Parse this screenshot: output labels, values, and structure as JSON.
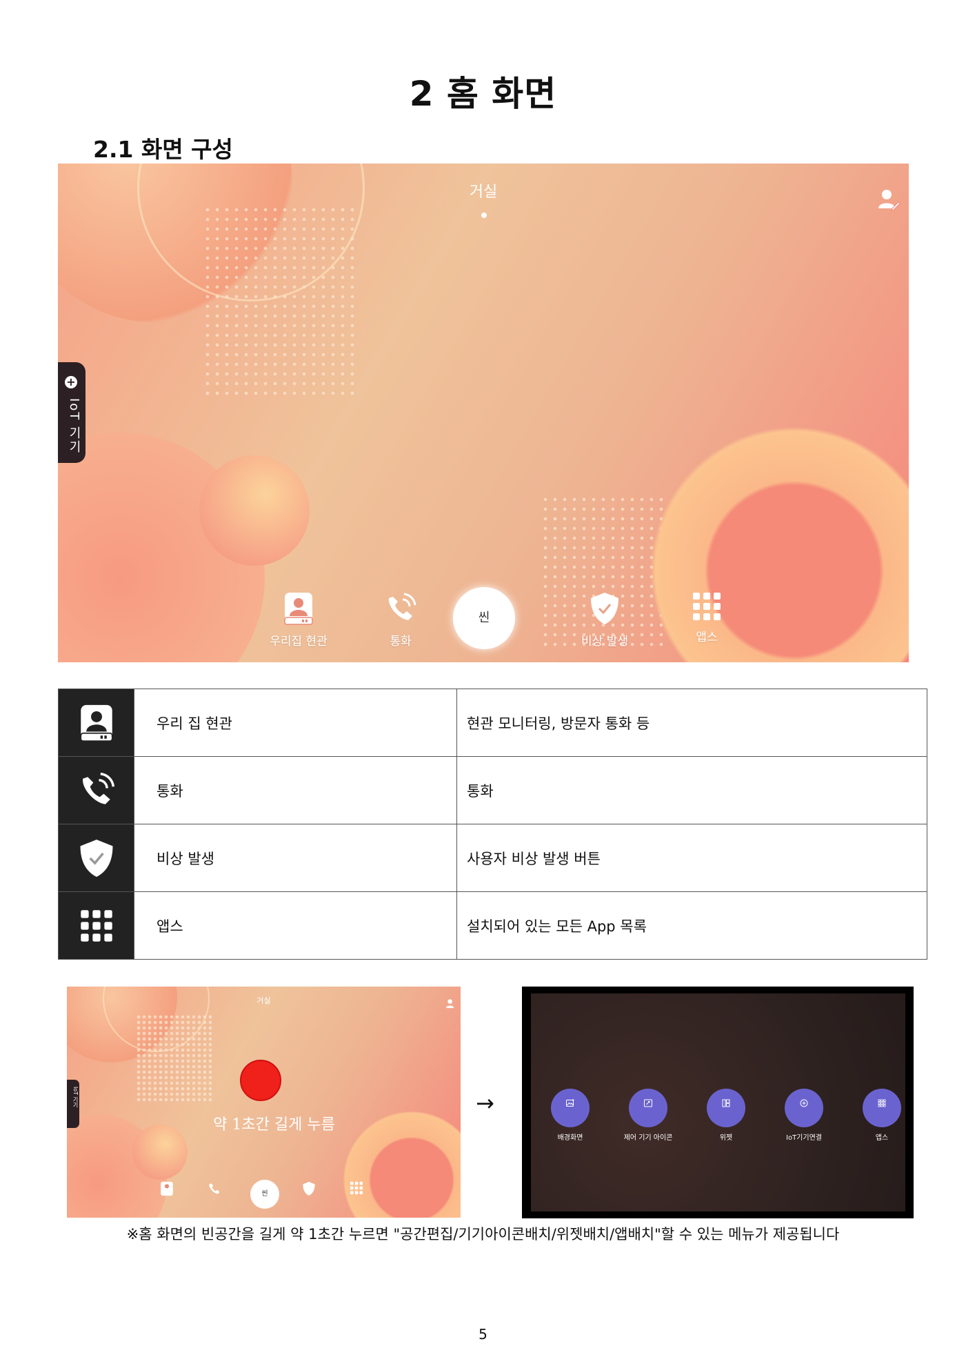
{
  "header": {
    "title": "2 홈 화면",
    "subtitle": "2.1 화면 구성"
  },
  "home_screen": {
    "room_label": "거실",
    "iot_tab_label": "IoT 기기",
    "scene_label": "씬",
    "dock": [
      {
        "label": "우리집 현관",
        "icon": "door-intercom-icon"
      },
      {
        "label": "통화",
        "icon": "phone-icon"
      },
      {
        "label": "비상 발생",
        "icon": "shield-check-icon"
      },
      {
        "label": "앱스",
        "icon": "apps-grid-icon"
      }
    ],
    "colors": {
      "gradient_start": "#f6a287",
      "gradient_mid": "#efc39b",
      "gradient_end": "#f6857a",
      "tab_dark": "#2d2024"
    }
  },
  "feature_table": [
    {
      "icon": "door-intercom-icon",
      "name": "우리 집 현관",
      "description": "현관 모니터링, 방문자 통화 등"
    },
    {
      "icon": "phone-icon",
      "name": "통화",
      "description": "통화"
    },
    {
      "icon": "shield-check-icon",
      "name": "비상 발생",
      "description": "사용자 비상 발생 버튼"
    },
    {
      "icon": "apps-grid-icon",
      "name": "앱스",
      "description": "설치되어 있는 모든 App 목록"
    }
  ],
  "long_press_example": {
    "room_label": "거실",
    "hint": "약 1초간 길게 누름",
    "iot_tab_label": "IoT 기기",
    "scene_label": "씬",
    "arrow": "→"
  },
  "edit_menu": {
    "items": [
      {
        "label": "배경화면",
        "icon": "wallpaper-icon"
      },
      {
        "label": "제어 기기 아이콘",
        "icon": "device-icon-edit-icon"
      },
      {
        "label": "위젯",
        "icon": "widget-icon"
      },
      {
        "label": "IoT기기연결",
        "icon": "add-circle-icon"
      },
      {
        "label": "앱스",
        "icon": "apps-grid-icon"
      }
    ],
    "accent": "#6a63cf"
  },
  "note": "※홈 화면의 빈공간을 길게 약 1초간 누르면 \"공간편집/기기아이콘배치/위젯배치/앱배치\"할 수 있는 메뉴가 제공됩니다",
  "page_number": "5"
}
